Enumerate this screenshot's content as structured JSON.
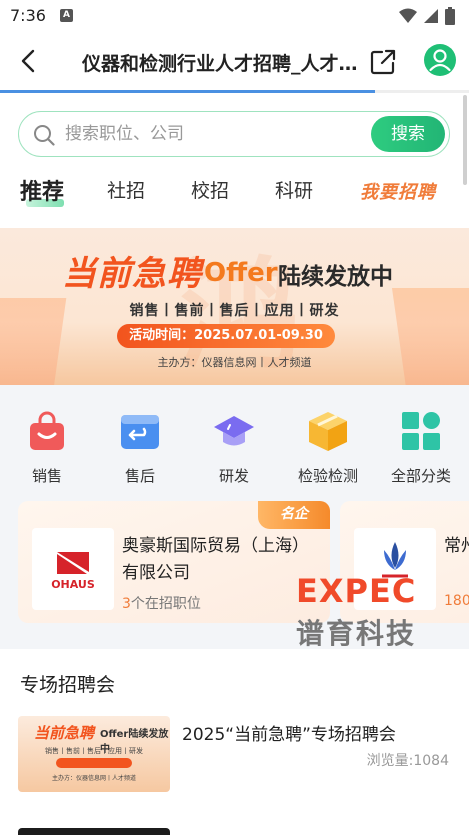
{
  "status_bar": {
    "time": "7:36",
    "sim_label": "A"
  },
  "header": {
    "title": "仪器和检测行业人才招聘_人才…",
    "progress": 0.8
  },
  "search": {
    "placeholder": "搜索职位、公司",
    "button_label": "搜索"
  },
  "tabs": [
    {
      "label": "推荐",
      "active": true
    },
    {
      "label": "社招",
      "active": false
    },
    {
      "label": "校招",
      "active": false
    },
    {
      "label": "科研",
      "active": false
    }
  ],
  "recruit_label": "我要招聘",
  "banner": {
    "title": "当前急聘",
    "offer": "Offer",
    "offer_rest": "陆续发放中",
    "subtitle": "销售丨售前丨售后丨应用丨研发",
    "period": "活动时间：2025.07.01-09.30",
    "organizer": "主办方：仪器信息网丨人才频道"
  },
  "categories": [
    {
      "label": "销售",
      "icon": "shopping-bag-icon",
      "color": "#f05a5a"
    },
    {
      "label": "售后",
      "icon": "return-icon",
      "color": "#4a8ff0"
    },
    {
      "label": "研发",
      "icon": "graduation-cap-icon",
      "color": "#7a6cf0"
    },
    {
      "label": "检验检测",
      "icon": "box-icon",
      "color": "#f7b733"
    },
    {
      "label": "全部分类",
      "icon": "grid-icon",
      "color": "#2ec4a6"
    }
  ],
  "companies": [
    {
      "name": "奥豪斯国际贸易（上海）有限公司",
      "jobs_count": "3",
      "jobs_suffix": "个在招职位",
      "badge": "名企",
      "logo_text": "OHAUS"
    },
    {
      "name": "常州",
      "jobs_count": "180",
      "jobs_suffix": "",
      "badge": "",
      "logo_text": ""
    }
  ],
  "watermark": {
    "top": "EXPEC",
    "bottom": "谱育科技"
  },
  "section": {
    "title": "专场招聘会",
    "fairs": [
      {
        "title": "2025“当前急聘”专场招聘会",
        "views": "浏览量:1084",
        "thumb_title": "当前急聘",
        "thumb_offer": "Offer陆续发放中",
        "thumb_sub": "销售丨售前丨售后丨应用丨研发",
        "thumb_org": "主办方：仪器信息网丨人才频道"
      }
    ]
  }
}
